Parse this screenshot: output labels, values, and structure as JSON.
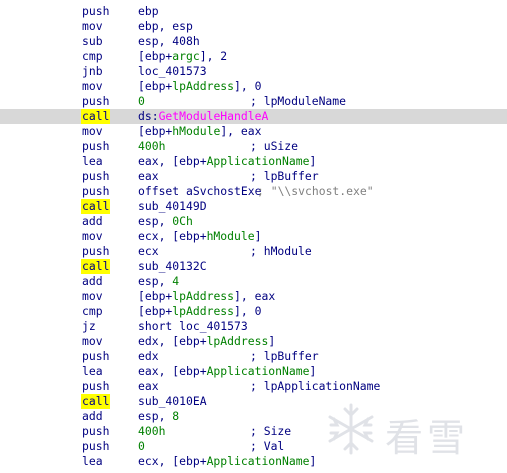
{
  "lines": [
    {
      "mn": "push",
      "op": "ebp"
    },
    {
      "mn": "mov",
      "op": "ebp, esp"
    },
    {
      "mn": "sub",
      "op": "esp, 408h"
    },
    {
      "mn": "cmp",
      "op_pre": "[ebp+",
      "op_hl": "argc",
      "op_post": "], 2"
    },
    {
      "mn": "jnb",
      "op": "loc_401573"
    },
    {
      "mn": "mov",
      "op_pre": "[ebp+",
      "op_hl": "lpAddress",
      "op_post": "], 0"
    },
    {
      "mn": "push",
      "op": "0",
      "op_green": true,
      "cm": "; lpModuleName"
    },
    {
      "mn": "call",
      "op_pre": "ds:",
      "op_magenta": "GetModuleHandleA",
      "highlight": true
    },
    {
      "mn": "mov",
      "op_pre": "[ebp+",
      "op_hl": "hModule",
      "op_post": "], eax"
    },
    {
      "mn": "push",
      "op": "400h",
      "op_green": true,
      "cm": "; uSize"
    },
    {
      "mn": "lea",
      "op_pre": "eax, [ebp+",
      "op_hl": "ApplicationName",
      "op_post": "]"
    },
    {
      "mn": "push",
      "op": "eax",
      "cm": "; lpBuffer"
    },
    {
      "mn": "push",
      "op": "offset aSvchostExe",
      "cm": "; \"\\\\svchost.exe\"",
      "cm_grey": true
    },
    {
      "mn": "call",
      "op": "sub_40149D"
    },
    {
      "mn": "add",
      "op_pre": "esp, ",
      "op_gr": "0Ch"
    },
    {
      "mn": "mov",
      "op_pre": "ecx, [ebp+",
      "op_hl": "hModule",
      "op_post": "]"
    },
    {
      "mn": "push",
      "op": "ecx",
      "cm": "; hModule"
    },
    {
      "mn": "call",
      "op": "sub_40132C"
    },
    {
      "mn": "add",
      "op_pre": "esp, ",
      "op_gr": "4"
    },
    {
      "mn": "mov",
      "op_pre": "[ebp+",
      "op_hl": "lpAddress",
      "op_post": "], eax"
    },
    {
      "mn": "cmp",
      "op_pre": "[ebp+",
      "op_hl": "lpAddress",
      "op_post": "], 0"
    },
    {
      "mn": "jz",
      "op": "short loc_401573"
    },
    {
      "mn": "mov",
      "op_pre": "edx, [ebp+",
      "op_hl": "lpAddress",
      "op_post": "]"
    },
    {
      "mn": "push",
      "op": "edx",
      "cm": "; lpBuffer"
    },
    {
      "mn": "lea",
      "op_pre": "eax, [ebp+",
      "op_hl": "ApplicationName",
      "op_post": "]"
    },
    {
      "mn": "push",
      "op": "eax",
      "cm": "; lpApplicationName"
    },
    {
      "mn": "call",
      "op": "sub_4010EA"
    },
    {
      "mn": "add",
      "op_pre": "esp, ",
      "op_gr": "8"
    },
    {
      "mn": "push",
      "op": "400h",
      "op_green": true,
      "cm": "; Size"
    },
    {
      "mn": "push",
      "op": "0",
      "op_green": true,
      "cm": "; Val"
    },
    {
      "mn": "lea",
      "op_pre": "ecx, [ebp+",
      "op_hl": "ApplicationName",
      "op_post": "]"
    }
  ],
  "watermark": {
    "text": "看雪",
    "icon": "snowflake-icon",
    "color": "#c8ccd4"
  },
  "colors": {
    "mnemonic": "#000080",
    "call_highlight": "#ffff00",
    "local_var": "#008000",
    "import": "#ff00ff",
    "line_highlight": "#d8d8d8",
    "comment_string": "#808080"
  }
}
